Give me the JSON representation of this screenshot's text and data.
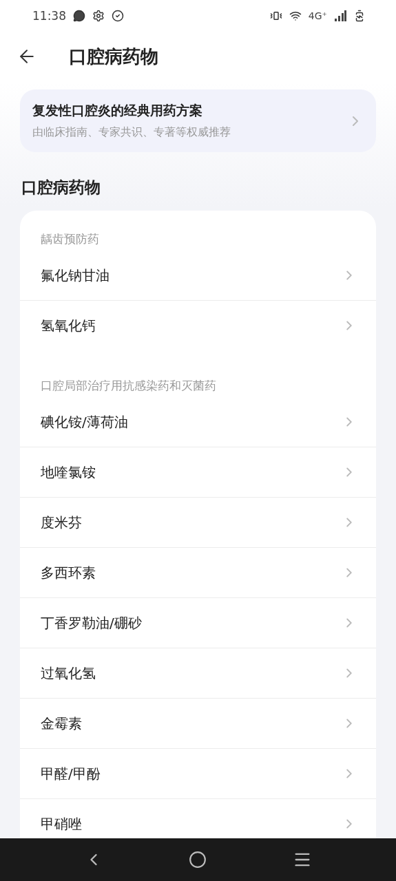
{
  "status_bar": {
    "time": "11:38",
    "network": "4G⁺"
  },
  "header": {
    "title": "口腔病药物"
  },
  "banner": {
    "title": "复发性口腔炎的经典用药方案",
    "subtitle": "由临床指南、专家共识、专著等权威推荐"
  },
  "section_title": "口腔病药物",
  "groups": [
    {
      "heading": "龋齿预防药",
      "items": [
        "氟化钠甘油",
        "氢氧化钙"
      ]
    },
    {
      "heading": "口腔局部治疗用抗感染药和灭菌药",
      "items": [
        "碘化铵/薄荷油",
        "地喹氯铵",
        "度米芬",
        "多西环素",
        "丁香罗勒油/硼砂",
        "过氧化氢",
        "金霉素",
        "甲醛/甲酚",
        "甲硝唑"
      ]
    }
  ]
}
